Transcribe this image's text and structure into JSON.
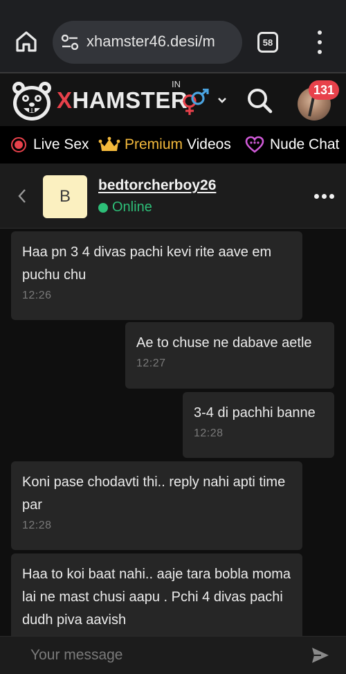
{
  "browser": {
    "url": "xhamster46.desi/m",
    "tab_count": "58"
  },
  "site": {
    "logo_x": "X",
    "logo_rest": "HAMSTER",
    "region": "IN",
    "notifications": "131"
  },
  "nav": {
    "live": "Live Sex",
    "premium_a": "Premium",
    "premium_b": "Videos",
    "nude": "Nude Chat"
  },
  "chat": {
    "contact_initial": "B",
    "contact_name": "bedtorcherboy26",
    "status": "Online",
    "messages": [
      {
        "side": "in",
        "text": "Haa pn 3 4 divas pachi kevi rite aave em puchu chu",
        "time": "12:26"
      },
      {
        "side": "out",
        "text": "Ae to chuse ne dabave aetle",
        "time": "12:27"
      },
      {
        "side": "out",
        "text": "3-4 di pachhi banne",
        "time": "12:28"
      },
      {
        "side": "in",
        "text": "Koni pase chodavti thi.. reply nahi apti time par",
        "time": "12:28"
      },
      {
        "side": "in",
        "text": "Haa to koi baat nahi.. aaje tara bobla moma lai ne mast chusi aapu . Pchi 4 divas pachi dudh piva aavish",
        "time": ""
      }
    ]
  },
  "composer": {
    "placeholder": "Your message"
  },
  "colors": {
    "brand_red": "#e8414b",
    "online_green": "#2dbf78",
    "premium_gold": "#f3b93c",
    "nude_chat_pink": "#d05ad8",
    "gender_male": "#4aa3e0"
  }
}
